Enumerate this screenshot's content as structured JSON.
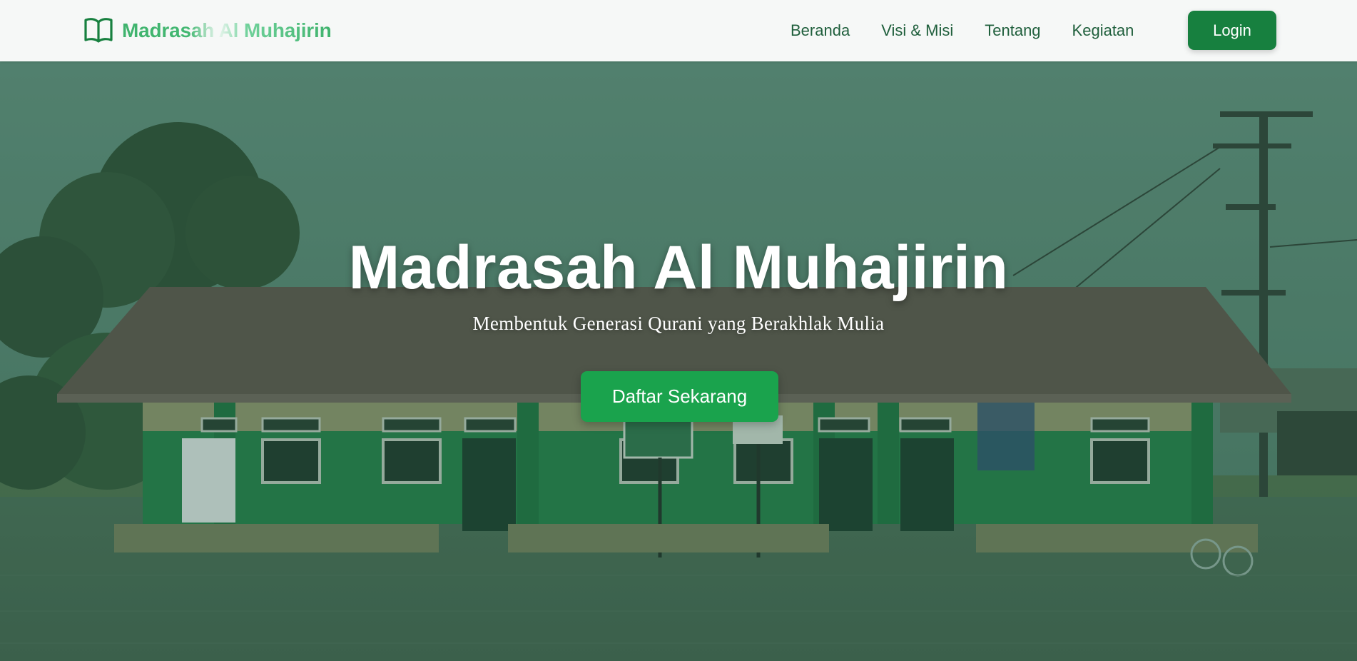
{
  "navbar": {
    "brand_text": "Madrasah Al Muhajirin",
    "brand_icon": "open-book-icon",
    "links": [
      "Beranda",
      "Visi & Misi",
      "Tentang",
      "Kegiatan"
    ],
    "login_label": "Login"
  },
  "hero": {
    "title": "Madrasah Al Muhajirin",
    "subtitle": "Membentuk Generasi Qurani yang Berakhlak Mulia",
    "cta_label": "Daftar Sekarang",
    "background": "school-building-photo"
  },
  "colors": {
    "brand_green": "#17803f",
    "cta_green": "#1aa34d",
    "nav_text": "#1f5f3c",
    "navbar_bg": "#f6f8f7",
    "hero_tint": "#2e6246"
  }
}
